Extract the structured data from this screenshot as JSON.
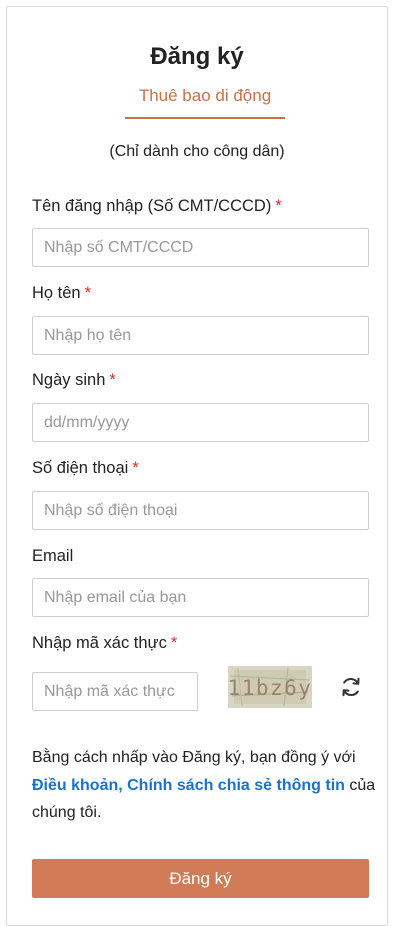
{
  "header": {
    "title": "Đăng ký",
    "tab_label": "Thuê bao di động",
    "subtitle": "(Chỉ dành cho công dân)"
  },
  "form": {
    "fields": [
      {
        "label": "Tên đăng nhập (Số CMT/CCCD)",
        "required_mark": "*",
        "placeholder": "Nhập số CMT/CCCD",
        "value": ""
      },
      {
        "label": "Họ tên",
        "required_mark": "*",
        "placeholder": "Nhập họ tên",
        "value": ""
      },
      {
        "label": "Ngày sinh",
        "required_mark": "*",
        "placeholder": "dd/mm/yyyy",
        "value": ""
      },
      {
        "label": "Số điện thoại",
        "required_mark": "*",
        "placeholder": "Nhập số điện thoại",
        "value": ""
      },
      {
        "label": "Email",
        "placeholder": "Nhập email của bạn",
        "value": ""
      }
    ],
    "captcha": {
      "label": "Nhập mã xác thực",
      "required_mark": "*",
      "placeholder": "Nhập mã xác thực",
      "code": "11bz6y",
      "refresh_icon": "refresh-icon"
    },
    "terms": {
      "prefix": "Bằng cách nhấp vào Đăng ký, bạn đồng ý với ",
      "link": "Điều khoản, Chính sách chia sẻ thông tin",
      "suffix": " của chúng tôi."
    },
    "submit_label": "Đăng ký"
  },
  "colors": {
    "accent": "#c8714a",
    "button": "#d07a56",
    "link": "#1a73c9",
    "required": "#e0282e"
  }
}
